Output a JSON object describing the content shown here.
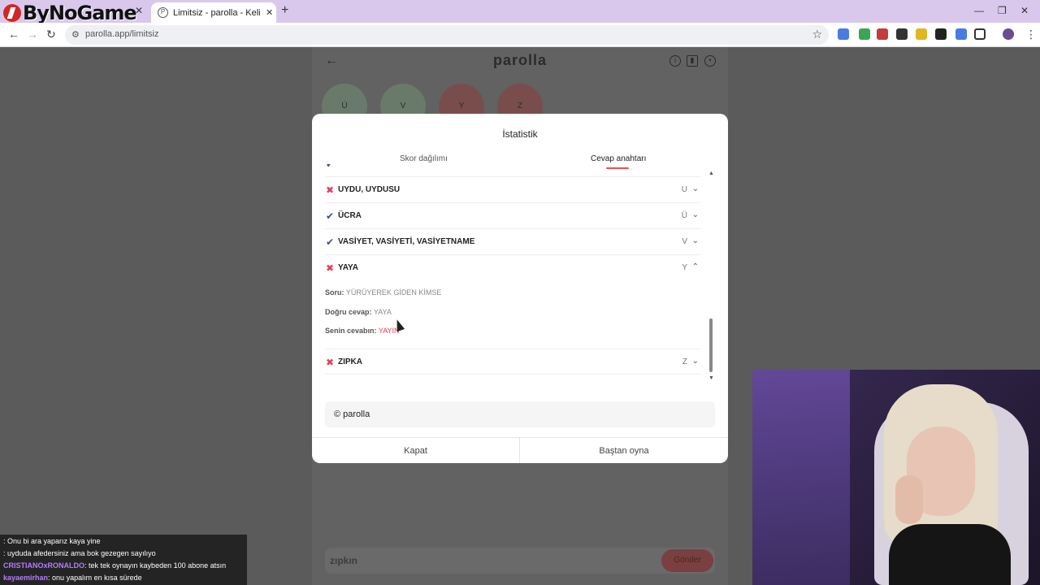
{
  "browser": {
    "brand": "ByNoGame",
    "tab_title": "Limitsiz - parolla - Kelime oyunu",
    "url": "parolla.app/limitsiz"
  },
  "page": {
    "title": "parolla",
    "bubbles": [
      "Ü",
      "V",
      "Y",
      "Z"
    ],
    "answer_value": "zıpkın",
    "answer_button": "Gönder"
  },
  "modal": {
    "title": "İstatistik",
    "tabs": {
      "score": "Skor dağılımı",
      "key": "Cevap anahtarı"
    },
    "rows": [
      {
        "word": "UYDU, UYDUSU",
        "letter": "U",
        "correct": false,
        "expanded": false
      },
      {
        "word": "ÜCRA",
        "letter": "Ü",
        "correct": true,
        "expanded": false
      },
      {
        "word": "VASİYET, VASİYETİ, VASİYETNAME",
        "letter": "V",
        "correct": true,
        "expanded": false
      },
      {
        "word": "YAYA",
        "letter": "Y",
        "correct": false,
        "expanded": true
      },
      {
        "word": "ZIPKA",
        "letter": "Z",
        "correct": false,
        "expanded": false
      }
    ],
    "detail": {
      "question_label": "Soru:",
      "question": "YÜRÜYEREK GİDEN KİMSE",
      "correct_label": "Doğru cevap:",
      "correct": "YAYA",
      "yours_label": "Senin cevabın:",
      "yours": "YAYIN"
    },
    "footer": "© parolla",
    "actions": {
      "close": "Kapat",
      "restart": "Baştan oyna"
    }
  },
  "chat": [
    {
      "user": "",
      "user_color": "#e0415a",
      "message": ": Onu bi ara yaparız kaya yine"
    },
    {
      "user": "",
      "user_color": "#e0415a",
      "message": ": uyduda afedersiniz ama bok gezegen sayılıyo"
    },
    {
      "user": "CRISTIANOxRONALDO",
      "user_color": "#b57bff",
      "message": ": tek tek oynayın kaybeden 100 abone atsın"
    },
    {
      "user": "kayaemirhan",
      "user_color": "#b57bff",
      "message": ": onu yapalım en kısa sürede"
    }
  ]
}
